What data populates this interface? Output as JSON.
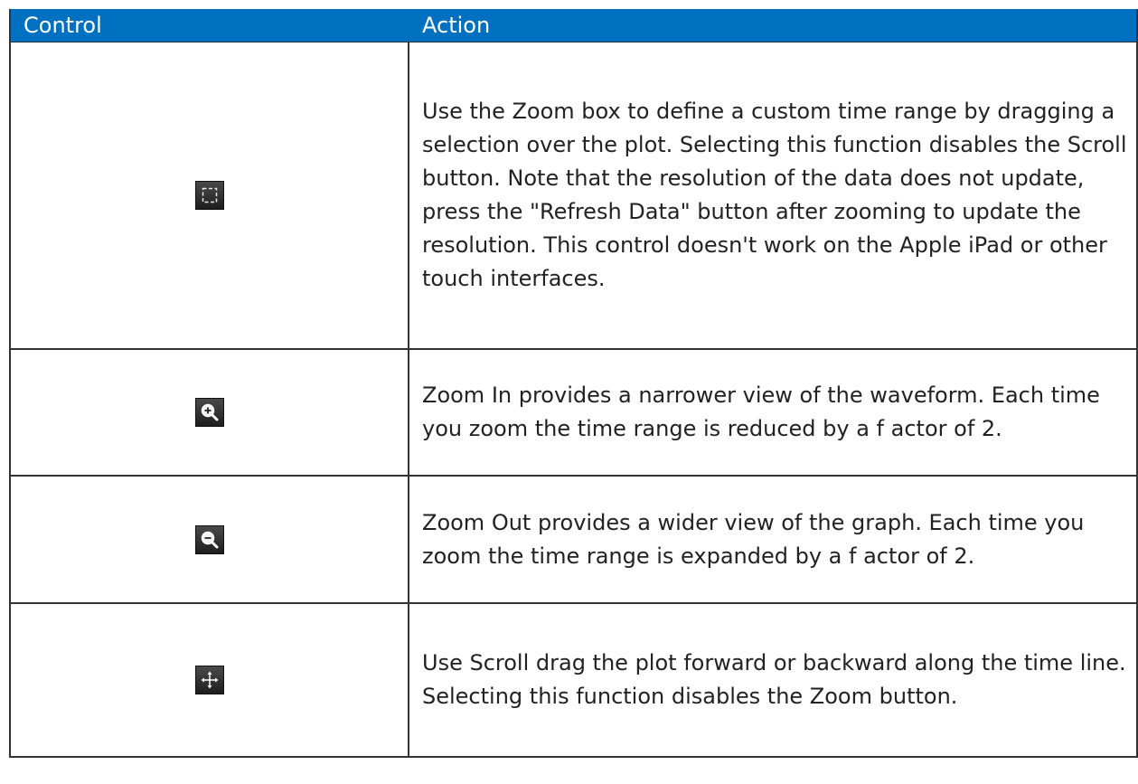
{
  "table": {
    "headers": {
      "control": "Control",
      "action": "Action"
    },
    "header_color": "#0070c0",
    "rows": [
      {
        "icon": "zoom-box-icon",
        "action": "Use the Zoom box to define a custom time range by dragging a selection over the plot. Selecting this function disables the Scroll button. Note that the resolution of the data does not update, press the \"Refresh Data\" button after zooming to update the resolution. This control doesn't work on the Apple iPad or other touch interfaces."
      },
      {
        "icon": "zoom-in-icon",
        "action": "Zoom In provides a narrower view of the waveform. Each time you zoom the time range is reduced by a f actor of 2."
      },
      {
        "icon": "zoom-out-icon",
        "action": "Zoom Out provides a wider view of the graph. Each time you zoom the time range is expanded by a f actor of 2."
      },
      {
        "icon": "scroll-move-icon",
        "action": "Use Scroll drag the plot forward or backward along the time line. Selecting this function disables the Zoom button."
      }
    ]
  }
}
